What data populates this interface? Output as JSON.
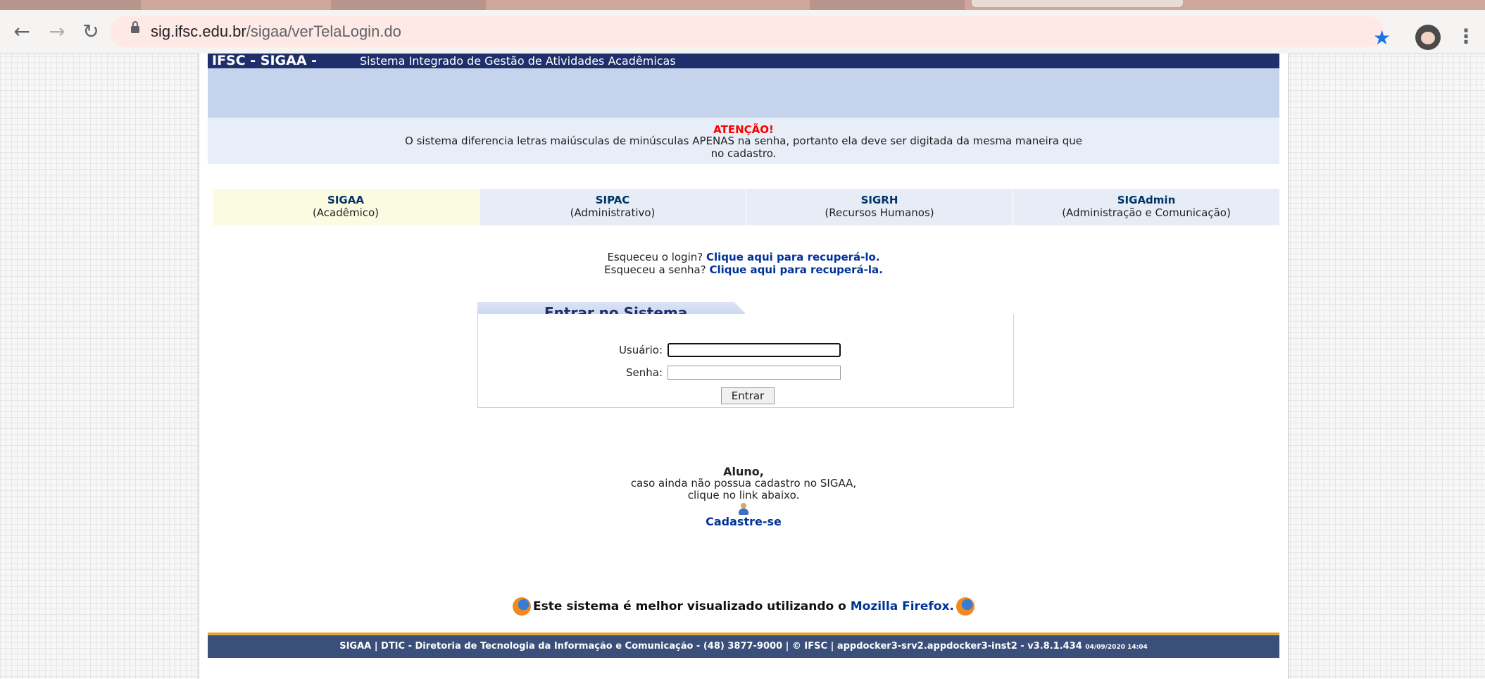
{
  "browser": {
    "url_domain": "sig.ifsc.edu.br",
    "url_path": "/sigaa/verTelaLogin.do"
  },
  "header": {
    "brand": "IFSC - SIGAA -",
    "subtitle": "Sistema Integrado de Gestão de Atividades Acadêmicas"
  },
  "warning": {
    "title": "ATENÇÃO!",
    "line1": "O sistema diferencia letras maiúsculas de minúsculas APENAS na senha, portanto ela deve ser digitada da mesma maneira que",
    "line2": "no cadastro."
  },
  "systems": [
    {
      "name": "SIGAA",
      "desc": "(Acadêmico)"
    },
    {
      "name": "SIPAC",
      "desc": "(Administrativo)"
    },
    {
      "name": "SIGRH",
      "desc": "(Recursos Humanos)"
    },
    {
      "name": "SIGAdmin",
      "desc": "(Administração e Comunicação)"
    }
  ],
  "recover": {
    "login_prefix": "Esqueceu o login?",
    "login_link": "Clique aqui para recuperá-lo.",
    "password_prefix": "Esqueceu a senha?",
    "password_link": "Clique aqui para recuperá-la."
  },
  "login": {
    "title": "Entrar no Sistema",
    "user_label": "Usuário:",
    "user_value": "",
    "password_label": "Senha:",
    "password_value": "",
    "submit": "Entrar"
  },
  "aluno": {
    "title": "Aluno,",
    "line1": "caso ainda não possua cadastro no SIGAA,",
    "line2": "clique no link abaixo.",
    "link": "Cadastre-se"
  },
  "firefox": {
    "text": "Este sistema é melhor visualizado utilizando o",
    "link": "Mozilla Firefox."
  },
  "footer": {
    "text": "SIGAA | DTIC - Diretoria de Tecnologia da Informação e Comunicação - (48) 3877-9000 | © IFSC | appdocker3-srv2.appdocker3-inst2 - v3.8.1.434",
    "timestamp": "04/09/2020 14:04"
  }
}
